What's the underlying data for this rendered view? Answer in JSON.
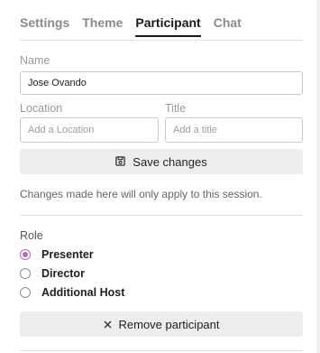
{
  "tabs": [
    {
      "label": "Settings"
    },
    {
      "label": "Theme"
    },
    {
      "label": "Participant"
    },
    {
      "label": "Chat"
    }
  ],
  "form": {
    "name_label": "Name",
    "name_value": "Jose Ovando",
    "location_label": "Location",
    "location_placeholder": "Add a Location",
    "title_label": "Title",
    "title_placeholder": "Add a title",
    "save_label": "Save changes",
    "note": "Changes made here will only apply to this session."
  },
  "role": {
    "label": "Role",
    "options": [
      {
        "label": "Presenter",
        "selected": true
      },
      {
        "label": "Director",
        "selected": false
      },
      {
        "label": "Additional Host",
        "selected": false
      }
    ]
  },
  "remove": {
    "label": "Remove participant"
  },
  "colors": {
    "accent": "#b56bb7"
  },
  "icons": {
    "save": "save-icon",
    "remove": "close-icon"
  }
}
